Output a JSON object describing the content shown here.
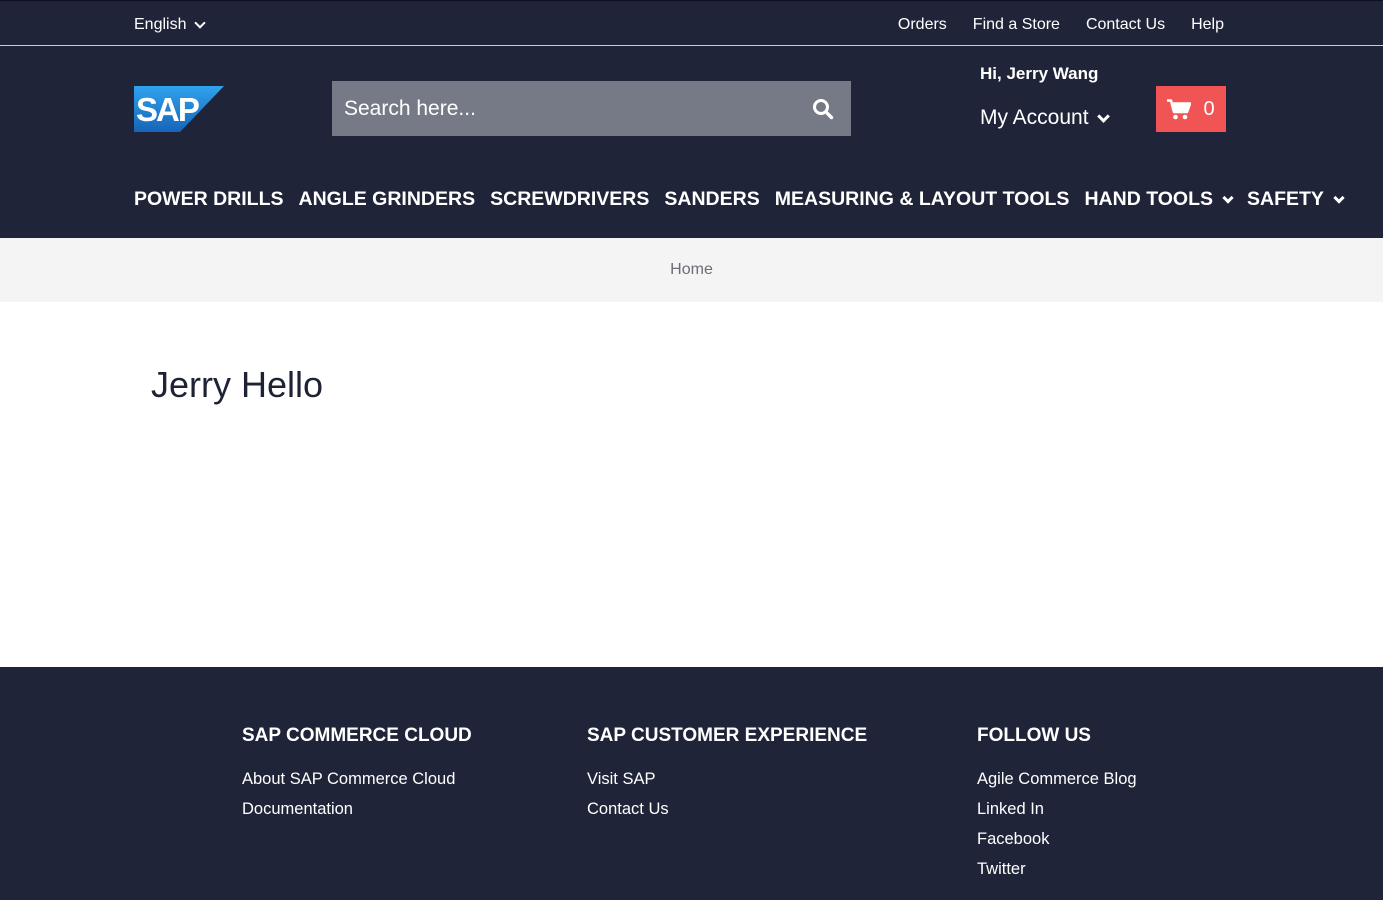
{
  "topbar": {
    "language": "English",
    "links": [
      "Orders",
      "Find a Store",
      "Contact Us",
      "Help"
    ]
  },
  "header": {
    "logo_text": "SAP",
    "search_placeholder": "Search here...",
    "greeting": "Hi, Jerry Wang",
    "account_label": "My Account",
    "cart_count": "0"
  },
  "nav": {
    "items": [
      "POWER DRILLS",
      "ANGLE GRINDERS",
      "SCREWDRIVERS",
      "SANDERS",
      "MEASURING & LAYOUT TOOLS",
      "HAND TOOLS",
      "SAFETY"
    ]
  },
  "breadcrumb": {
    "home": "Home"
  },
  "main": {
    "title": "Jerry Hello"
  },
  "footer": {
    "columns": [
      {
        "heading": "SAP COMMERCE CLOUD",
        "links": [
          "About SAP Commerce Cloud",
          "Documentation"
        ]
      },
      {
        "heading": "SAP CUSTOMER EXPERIENCE",
        "links": [
          "Visit SAP",
          "Contact Us"
        ]
      },
      {
        "heading": "FOLLOW US",
        "links": [
          "Agile Commerce Blog",
          "Linked In",
          "Facebook",
          "Twitter"
        ]
      }
    ]
  },
  "colors": {
    "header_bg": "#1f2438",
    "cart_bg": "#f05454",
    "search_bg": "#767a86",
    "breadcrumb_bg": "#f4f4f4",
    "sap_blue": "#1a73c9"
  },
  "icons": [
    "chevron-down-icon",
    "search-icon",
    "cart-icon"
  ]
}
